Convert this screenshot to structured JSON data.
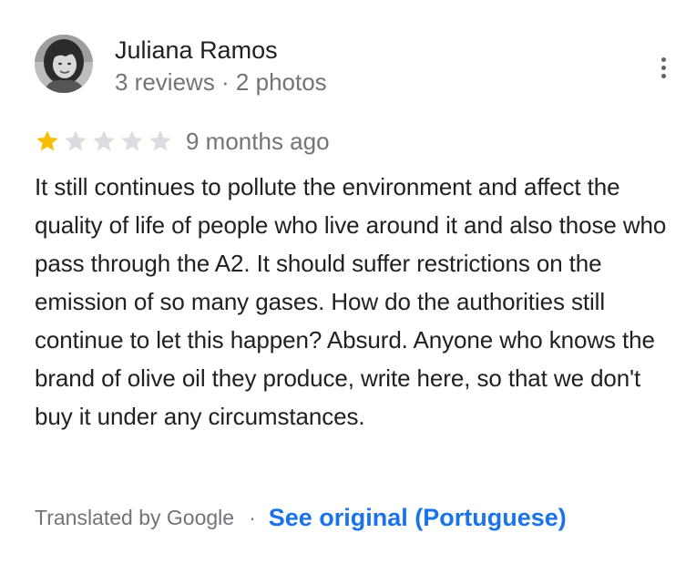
{
  "author": {
    "name": "Juliana Ramos",
    "meta": "3 reviews · 2 photos"
  },
  "review": {
    "rating": 1,
    "max_rating": 5,
    "date": "9 months ago",
    "text": "It still continues to pollute the environment and affect the quality of life of people who live around it and also those who pass through the A2. It should suffer restrictions on the emission of so many gases. How do the authorities still continue to let this happen? Absurd. Anyone who knows the brand of olive oil they produce, write here, so that we don't buy it under any circumstances."
  },
  "translation": {
    "translated_by": "Translated by Google",
    "separator": "·",
    "see_original": "See original (Portuguese)"
  },
  "icons": {
    "avatar": "profile-photo",
    "more": "more-vert-icon",
    "star_filled": "star-filled-icon",
    "star_empty": "star-empty-icon"
  },
  "colors": {
    "star_filled": "#fbbc04",
    "star_empty": "#dadce0",
    "link": "#1a73e8",
    "secondary_text": "#70757a",
    "primary_text": "#202124"
  }
}
